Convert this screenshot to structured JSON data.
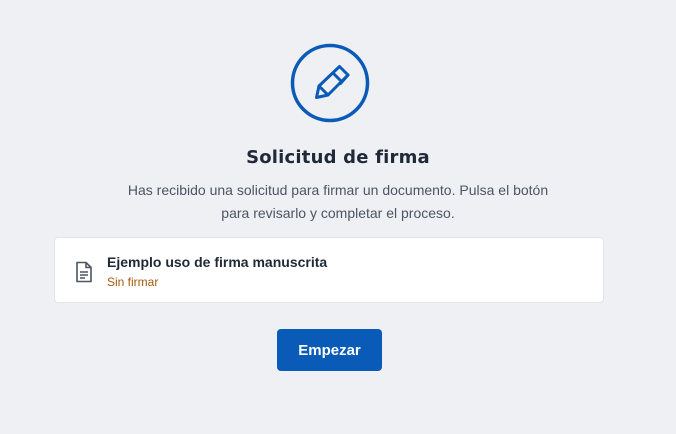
{
  "header": {
    "icon": "pen-signature-icon",
    "title": "Solicitud de firma",
    "description": "Has recibido una solicitud para firmar un documento. Pulsa el botón para revisarlo y completar el proceso."
  },
  "document": {
    "icon": "document-icon",
    "name": "Ejemplo uso de firma manuscrita",
    "status": "Sin firmar",
    "status_color": "#a35a0a"
  },
  "actions": {
    "start_label": "Empezar"
  },
  "colors": {
    "accent": "#0a5bb8",
    "background": "#eff0f4"
  }
}
